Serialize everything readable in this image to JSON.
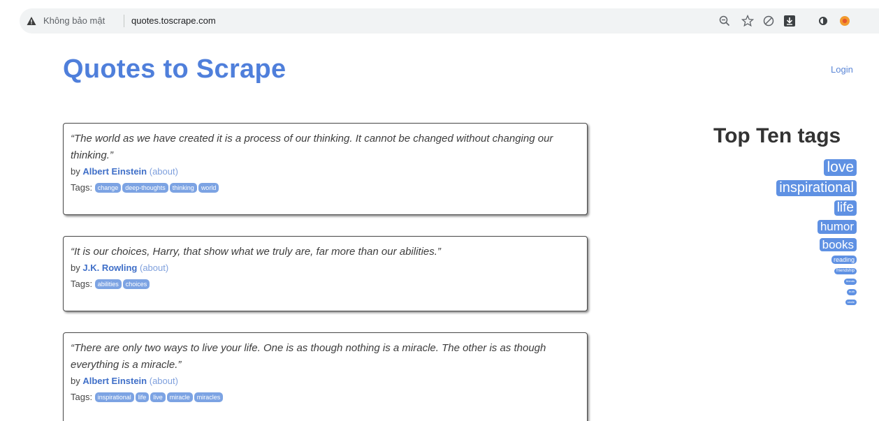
{
  "browser": {
    "security_label": "Không bảo mật",
    "url": "quotes.toscrape.com",
    "icons": [
      "warning-icon",
      "zoom-out-icon",
      "star-icon",
      "shield-icon",
      "download-icon",
      "circle-icon",
      "extension-icon"
    ]
  },
  "header": {
    "title": "Quotes to Scrape",
    "login": "Login"
  },
  "quotes": [
    {
      "text": "“The world as we have created it is a process of our thinking. It cannot be changed without changing our thinking.”",
      "by": "by",
      "author": "Albert Einstein",
      "about": "(about)",
      "tags_label": "Tags:",
      "tags": [
        "change",
        "deep-thoughts",
        "thinking",
        "world"
      ]
    },
    {
      "text": "“It is our choices, Harry, that show what we truly are, far more than our abilities.”",
      "by": "by",
      "author": "J.K. Rowling",
      "about": "(about)",
      "tags_label": "Tags:",
      "tags": [
        "abilities",
        "choices"
      ]
    },
    {
      "text": "“There are only two ways to live your life. One is as though nothing is a miracle. The other is as though everything is a miracle.”",
      "by": "by",
      "author": "Albert Einstein",
      "about": "(about)",
      "tags_label": "Tags:",
      "tags": [
        "inspirational",
        "life",
        "live",
        "miracle",
        "miracles"
      ]
    }
  ],
  "sidebar": {
    "title": "Top Ten tags",
    "tags": [
      "love",
      "inspirational",
      "life",
      "humor",
      "books",
      "reading",
      "friendship",
      "friends",
      "truth",
      "simile"
    ]
  },
  "colors": {
    "brand": "#4f7fdb",
    "tag_bg": "#7ca3e3",
    "side_tag_bg": "#5f91e3"
  }
}
